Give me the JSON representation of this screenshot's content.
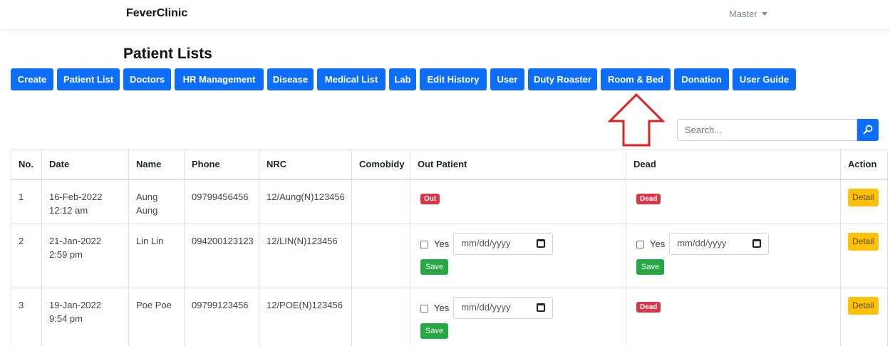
{
  "navbar": {
    "brand": "FeverClinic",
    "user_menu": "Master"
  },
  "page_title": "Patient Lists",
  "menu": [
    {
      "label": "Create"
    },
    {
      "label": "Patient List"
    },
    {
      "label": "Doctors"
    },
    {
      "label": "HR Management"
    },
    {
      "label": "Disease"
    },
    {
      "label": "Medical List"
    },
    {
      "label": "Lab"
    },
    {
      "label": "Edit History"
    },
    {
      "label": "User"
    },
    {
      "label": "Duty Roaster"
    },
    {
      "label": "Room & Bed"
    },
    {
      "label": "Donation"
    },
    {
      "label": "User Guide"
    }
  ],
  "search": {
    "placeholder": "Search..."
  },
  "table": {
    "headers": [
      "No.",
      "Date",
      "Name",
      "Phone",
      "NRC",
      "Comobidy",
      "Out Patient",
      "Dead",
      "Action"
    ],
    "rows": [
      {
        "no": "1",
        "date": "16-Feb-2022 12:12 am",
        "name": "Aung Aung",
        "phone": "09799456456",
        "nrc": "12/Aung(N)123456",
        "comobidy": "",
        "out_badge": "Out",
        "dead_badge": "Dead",
        "action": "Detail"
      },
      {
        "no": "2",
        "date": "21-Jan-2022 2:59 pm",
        "name": "Lin Lin",
        "phone": "094200123123",
        "nrc": "12/LIN(N)123456",
        "comobidy": "",
        "out_yes": "Yes",
        "out_date": "mm/dd/yyyy",
        "out_save": "Save",
        "dead_yes": "Yes",
        "dead_date": "mm/dd/yyyy",
        "dead_save": "Save",
        "action": "Detail"
      },
      {
        "no": "3",
        "date": "19-Jan-2022 9:54 pm",
        "name": "Poe Poe",
        "phone": "09799123456",
        "nrc": "12/POE(N)123456",
        "comobidy": "",
        "out_yes": "Yes",
        "out_date": "mm/dd/yyyy",
        "out_save": "Save",
        "dead_badge": "Dead",
        "action": "Detail"
      }
    ]
  },
  "colors": {
    "primary": "#0d6efd",
    "danger": "#dc3545",
    "success": "#28a745",
    "warning": "#ffc107",
    "annotation": "#e02020"
  },
  "icons": {
    "search": "search-icon",
    "calendar": "calendar-icon",
    "caret": "caret-down-icon",
    "annotation": "arrow-up-icon"
  }
}
